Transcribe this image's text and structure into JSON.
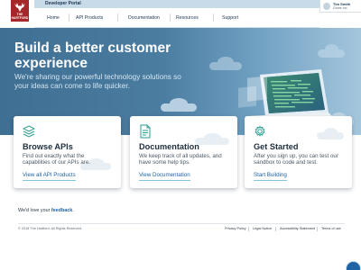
{
  "header": {
    "logo_text": "THE HARTFORD",
    "portal_title": "Developer Portal",
    "nav": [
      "Home",
      "API Products",
      "Documentation",
      "Resources",
      "Support"
    ],
    "user": {
      "name": "Tim Smith",
      "org": "Globe Inc."
    }
  },
  "hero": {
    "title": "Build a better customer experience",
    "subtitle": "We're sharing our powerful technology solutions so your ideas can come to life quicker."
  },
  "cards": [
    {
      "icon": "layers-icon",
      "title": "Browse APIs",
      "text": "Find out exactly what the capabilities of our APIs are.",
      "link": "View all API Products"
    },
    {
      "icon": "document-icon",
      "title": "Documentation",
      "text": "We keep track of all updates, and have some help tips.",
      "link": "View Documentation"
    },
    {
      "icon": "gear-icon",
      "title": "Get Started",
      "text": "After you sign up, you can test our sandbox to code and test.",
      "link": "Start Building"
    }
  ],
  "feedback": {
    "text": "We'd love your ",
    "link": "feedback",
    "suffix": "."
  },
  "footer": {
    "copyright": "© 2018 The Hartford. All Rights Reserved.",
    "links": [
      "Privacy Policy",
      "Legal Notice",
      "Accessibility Statement",
      "Terms of use"
    ]
  },
  "colors": {
    "brand_red": "#a6272a",
    "hero_blue": "#4b7da1",
    "link_blue": "#1e63a4",
    "accent_teal": "#83c3de"
  }
}
